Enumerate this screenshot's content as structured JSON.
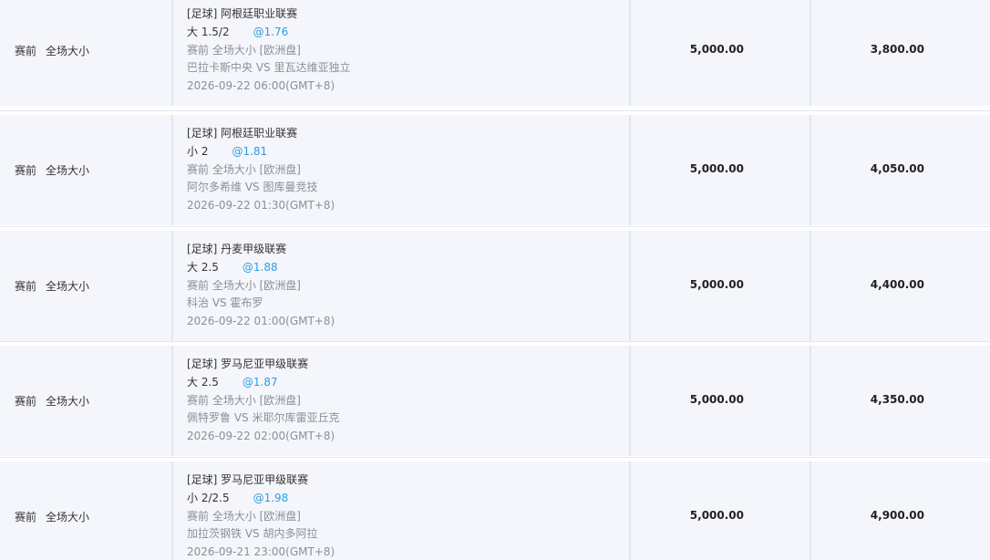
{
  "rows": [
    {
      "stage": "赛前",
      "market": "全场大小",
      "league": "[足球] 阿根廷职业联赛",
      "selection": "大 1.5/2",
      "odds": "@1.76",
      "market_line": "赛前 全场大小 [欧洲盘]",
      "teams": "巴拉卡斯中央 VS 里瓦达维亚独立",
      "time": "2026-09-22 06:00(GMT+8)",
      "stake": "5,000.00",
      "payout": "3,800.00"
    },
    {
      "stage": "赛前",
      "market": "全场大小",
      "league": "[足球] 阿根廷职业联赛",
      "selection": "小 2",
      "odds": "@1.81",
      "market_line": "赛前 全场大小 [欧洲盘]",
      "teams": "阿尔多希维 VS 图库曼竞技",
      "time": "2026-09-22 01:30(GMT+8)",
      "stake": "5,000.00",
      "payout": "4,050.00"
    },
    {
      "stage": "赛前",
      "market": "全场大小",
      "league": "[足球] 丹麦甲级联赛",
      "selection": "大 2.5",
      "odds": "@1.88",
      "market_line": "赛前 全场大小 [欧洲盘]",
      "teams": "科治 VS 霍布罗",
      "time": "2026-09-22 01:00(GMT+8)",
      "stake": "5,000.00",
      "payout": "4,400.00"
    },
    {
      "stage": "赛前",
      "market": "全场大小",
      "league": "[足球] 罗马尼亚甲级联赛",
      "selection": "大 2.5",
      "odds": "@1.87",
      "market_line": "赛前 全场大小 [欧洲盘]",
      "teams": "佩特罗鲁 VS 米耶尔库雷亚丘克",
      "time": "2026-09-22 02:00(GMT+8)",
      "stake": "5,000.00",
      "payout": "4,350.00"
    },
    {
      "stage": "赛前",
      "market": "全场大小",
      "league": "[足球] 罗马尼亚甲级联赛",
      "selection": "小 2/2.5",
      "odds": "@1.98",
      "market_line": "赛前 全场大小 [欧洲盘]",
      "teams": "加拉茨钢铁 VS 胡内多阿拉",
      "time": "2026-09-21 23:00(GMT+8)",
      "stake": "5,000.00",
      "payout": "4,900.00"
    }
  ],
  "colors": {
    "row_bg": "#f4f6fb",
    "divider": "#e2e6ef",
    "odds": "#2d9ee0",
    "muted_text": "#8c8f96"
  }
}
